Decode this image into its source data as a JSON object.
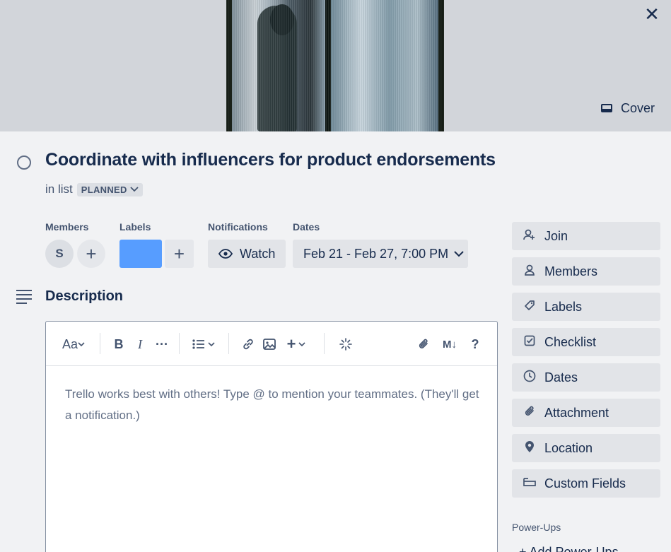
{
  "cover": {
    "button_label": "Cover",
    "close_glyph": "✕"
  },
  "card": {
    "title": "Coordinate with influencers for product endorsements",
    "in_list_prefix": "in list",
    "list_name": "PLANNED"
  },
  "meta": {
    "members_label": "Members",
    "member_initial": "S",
    "labels_label": "Labels",
    "label_color": "#579dff",
    "notifications_label": "Notifications",
    "watch_label": "Watch",
    "dates_label": "Dates",
    "dates_value": "Feb 21 - Feb 27, 7:00 PM"
  },
  "description": {
    "title": "Description",
    "placeholder": "Trello works best with others! Type @ to mention your teammates. (They'll get a notification.)",
    "toolbar": {
      "text_style": "Aa",
      "bold": "B",
      "italic": "I",
      "more": "···",
      "markdown": "M↓",
      "help": "?"
    }
  },
  "sidebar": {
    "buttons": [
      {
        "label": "Join",
        "icon": "add-person-icon"
      },
      {
        "label": "Members",
        "icon": "person-icon"
      },
      {
        "label": "Labels",
        "icon": "tag-icon"
      },
      {
        "label": "Checklist",
        "icon": "checkbox-icon"
      },
      {
        "label": "Dates",
        "icon": "clock-icon"
      },
      {
        "label": "Attachment",
        "icon": "paperclip-icon"
      },
      {
        "label": "Location",
        "icon": "pin-icon"
      },
      {
        "label": "Custom Fields",
        "icon": "custom-fields-icon"
      }
    ],
    "powerups_label": "Power-Ups",
    "add_powerups_label": "+ Add Power-Ups"
  },
  "colors": {
    "background": "#f1f2f4",
    "cover_bg": "#d2d5da",
    "button_bg": "#e2e4e8",
    "text": "#172b4d",
    "label_blue": "#579dff"
  }
}
